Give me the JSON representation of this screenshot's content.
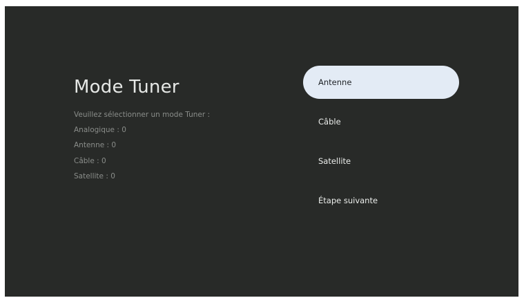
{
  "page": {
    "title": "Mode Tuner",
    "info_lines": [
      "Veuillez sélectionner un mode Tuner :",
      "Analogique : 0",
      "Antenne : 0",
      "Câble : 0",
      "Satellite : 0"
    ]
  },
  "menu": {
    "selected_index": 0,
    "items": [
      {
        "label": "Antenne"
      },
      {
        "label": "Câble"
      },
      {
        "label": "Satellite"
      },
      {
        "label": "Étape suivante"
      }
    ]
  },
  "colors": {
    "background": "#282a28",
    "title": "#e6e8e6",
    "info_text": "#8a8d8a",
    "menu_text": "#eceeec",
    "selected_pill": "#e3ebf5",
    "selected_text": "#1e2226"
  }
}
